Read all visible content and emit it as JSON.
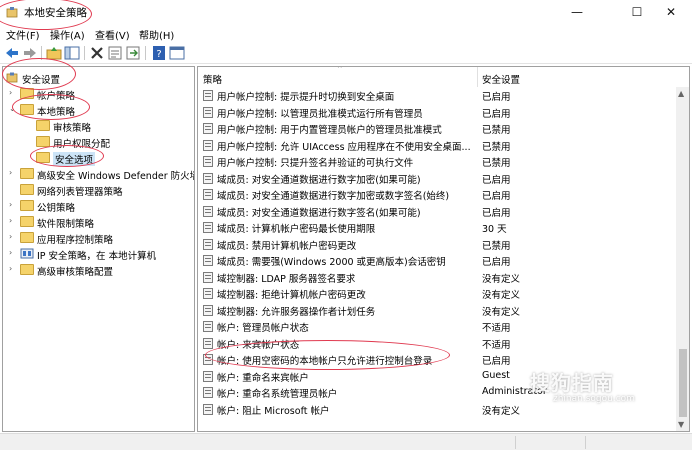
{
  "window": {
    "title": "本地安全策略",
    "icon": "security-policy-app-icon",
    "controls": {
      "minimize": "—",
      "maximize": "☐",
      "close": "✕"
    }
  },
  "menu": {
    "file": "文件(F)",
    "action": "操作(A)",
    "view": "查看(V)",
    "help": "帮助(H)"
  },
  "toolbar": {
    "icons": [
      "back-icon",
      "forward-icon",
      "up-folder-icon",
      "show-tree-icon",
      "delete-icon",
      "properties-icon",
      "export-icon",
      "help-icon",
      "console-icon"
    ]
  },
  "tree": {
    "root": "安全设置",
    "items": [
      {
        "label": "帐户策略",
        "expander": "›"
      },
      {
        "label": "本地策略",
        "expander": "⌄"
      },
      {
        "label": "审核策略",
        "expander": ""
      },
      {
        "label": "用户权限分配",
        "expander": ""
      },
      {
        "label": "安全选项",
        "expander": ""
      },
      {
        "label": "高级安全 Windows Defender 防火墙",
        "expander": "›"
      },
      {
        "label": "网络列表管理器策略",
        "expander": ""
      },
      {
        "label": "公钥策略",
        "expander": "›"
      },
      {
        "label": "软件限制策略",
        "expander": "›"
      },
      {
        "label": "应用程序控制策略",
        "expander": "›"
      },
      {
        "label": "IP 安全策略，在 本地计算机",
        "expander": "›"
      },
      {
        "label": "高级审核策略配置",
        "expander": "›"
      }
    ]
  },
  "list": {
    "col_policy": "策略",
    "col_setting": "安全设置",
    "sort_indicator": "⌃",
    "rows": [
      {
        "policy": "用户帐户控制: 提示提升时切换到安全桌面",
        "setting": "已启用"
      },
      {
        "policy": "用户帐户控制: 以管理员批准模式运行所有管理员",
        "setting": "已启用"
      },
      {
        "policy": "用户帐户控制: 用于内置管理员帐户的管理员批准模式",
        "setting": "已禁用"
      },
      {
        "policy": "用户帐户控制: 允许 UIAccess 应用程序在不使用安全桌面...",
        "setting": "已禁用"
      },
      {
        "policy": "用户帐户控制: 只提升签名并验证的可执行文件",
        "setting": "已禁用"
      },
      {
        "policy": "域成员: 对安全通道数据进行数字加密(如果可能)",
        "setting": "已启用"
      },
      {
        "policy": "域成员: 对安全通道数据进行数字加密或数字签名(始终)",
        "setting": "已启用"
      },
      {
        "policy": "域成员: 对安全通道数据进行数字签名(如果可能)",
        "setting": "已启用"
      },
      {
        "policy": "域成员: 计算机帐户密码最长使用期限",
        "setting": "30 天"
      },
      {
        "policy": "域成员: 禁用计算机帐户密码更改",
        "setting": "已禁用"
      },
      {
        "policy": "域成员: 需要强(Windows 2000 或更高版本)会话密钥",
        "setting": "已启用"
      },
      {
        "policy": "域控制器: LDAP 服务器签名要求",
        "setting": "没有定义"
      },
      {
        "policy": "域控制器: 拒绝计算机帐户密码更改",
        "setting": "没有定义"
      },
      {
        "policy": "域控制器: 允许服务器操作者计划任务",
        "setting": "没有定义"
      },
      {
        "policy": "帐户: 管理员帐户状态",
        "setting": "不适用"
      },
      {
        "policy": "帐户: 来宾帐户状态",
        "setting": "不适用"
      },
      {
        "policy": "帐户: 使用空密码的本地帐户只允许进行控制台登录",
        "setting": "已启用"
      },
      {
        "policy": "帐户: 重命名来宾帐户",
        "setting": "Guest"
      },
      {
        "policy": "帐户: 重命名系统管理员帐户",
        "setting": "Administrator"
      },
      {
        "policy": "帐户: 阻止 Microsoft 帐户",
        "setting": "没有定义"
      }
    ]
  },
  "scrollbar": {
    "up": "▲",
    "down": "▼",
    "position_fraction": 0.85
  },
  "watermark": {
    "text": "搜狗指南",
    "url": "zhinan.sogou.com"
  },
  "colors": {
    "annotation": "#e03a50",
    "selection": "#cce4f7",
    "folder": "#f5d36a"
  }
}
